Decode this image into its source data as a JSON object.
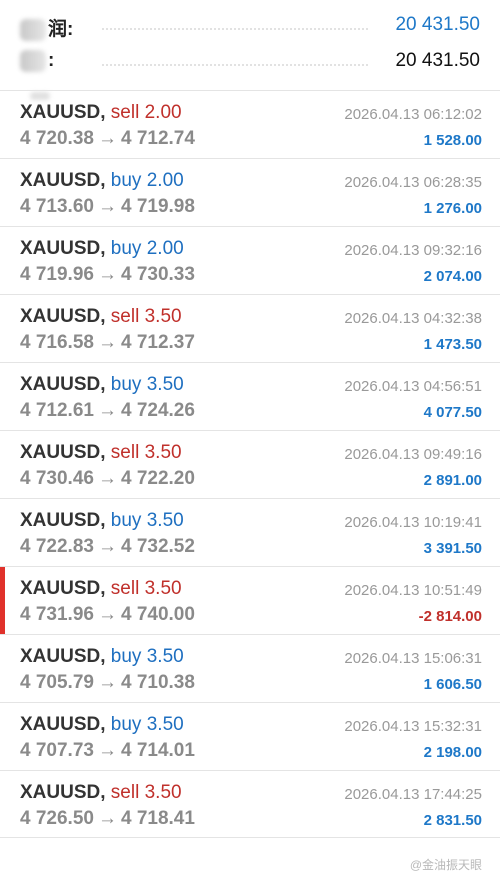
{
  "summary": {
    "row1": {
      "label_suffix": "润:",
      "value": "20 431.50"
    },
    "row2": {
      "label_suffix": ":",
      "value": "20 431.50"
    }
  },
  "trades": [
    {
      "symbol": "XAUUSD",
      "side": "sell",
      "volume": "2.00",
      "open": "4 720.38",
      "close": "4 712.74",
      "time": "2026.04.13 06:12:02",
      "profit": "1 528.00"
    },
    {
      "symbol": "XAUUSD",
      "side": "buy",
      "volume": "2.00",
      "open": "4 713.60",
      "close": "4 719.98",
      "time": "2026.04.13 06:28:35",
      "profit": "1 276.00"
    },
    {
      "symbol": "XAUUSD",
      "side": "buy",
      "volume": "2.00",
      "open": "4 719.96",
      "close": "4 730.33",
      "time": "2026.04.13 09:32:16",
      "profit": "2 074.00"
    },
    {
      "symbol": "XAUUSD",
      "side": "sell",
      "volume": "3.50",
      "open": "4 716.58",
      "close": "4 712.37",
      "time": "2026.04.13 04:32:38",
      "profit": "1 473.50"
    },
    {
      "symbol": "XAUUSD",
      "side": "buy",
      "volume": "3.50",
      "open": "4 712.61",
      "close": "4 724.26",
      "time": "2026.04.13 04:56:51",
      "profit": "4 077.50"
    },
    {
      "symbol": "XAUUSD",
      "side": "sell",
      "volume": "3.50",
      "open": "4 730.46",
      "close": "4 722.20",
      "time": "2026.04.13 09:49:16",
      "profit": "2 891.00"
    },
    {
      "symbol": "XAUUSD",
      "side": "buy",
      "volume": "3.50",
      "open": "4 722.83",
      "close": "4 732.52",
      "time": "2026.04.13 10:19:41",
      "profit": "3 391.50"
    },
    {
      "symbol": "XAUUSD",
      "side": "sell",
      "volume": "3.50",
      "open": "4 731.96",
      "close": "4 740.00",
      "time": "2026.04.13 10:51:49",
      "profit": "-2 814.00",
      "loss": true
    },
    {
      "symbol": "XAUUSD",
      "side": "buy",
      "volume": "3.50",
      "open": "4 705.79",
      "close": "4 710.38",
      "time": "2026.04.13 15:06:31",
      "profit": "1 606.50"
    },
    {
      "symbol": "XAUUSD",
      "side": "buy",
      "volume": "3.50",
      "open": "4 707.73",
      "close": "4 714.01",
      "time": "2026.04.13 15:32:31",
      "profit": "2 198.00"
    },
    {
      "symbol": "XAUUSD",
      "side": "sell",
      "volume": "3.50",
      "open": "4 726.50",
      "close": "4 718.41",
      "time": "2026.04.13 17:44:25",
      "profit": "2 831.50"
    }
  ],
  "arrow": "→",
  "watermark": "@金油振天眼",
  "colors": {
    "profit": "#1e78c8",
    "loss": "#c0302b",
    "sell": "#c0302b",
    "buy": "#1e6fc0"
  }
}
